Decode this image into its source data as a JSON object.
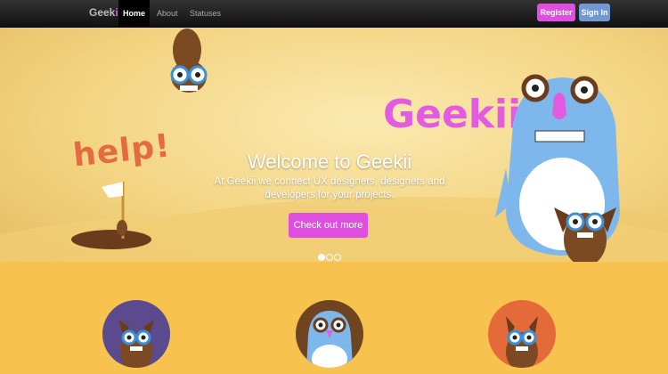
{
  "navbar": {
    "brand_prefix": "Geek",
    "brand_suffix": "ii",
    "items": [
      {
        "label": "Home",
        "active": true
      },
      {
        "label": "About",
        "active": false
      },
      {
        "label": "Statuses",
        "active": false
      }
    ],
    "register_label": "Register",
    "signin_label": "Sign In"
  },
  "hero": {
    "help_text": "help!",
    "logo_text": "Geekii",
    "title": "Welcome to Geekii",
    "subtitle": "At Geekii we connect UX designers, designers and developers for your projects.",
    "cta_label": "Check out more",
    "carousel": {
      "count": 3,
      "active_index": 0
    }
  },
  "features": {
    "circle_colors": [
      "#5b4a8d",
      "#6e4520",
      "#e56a3a"
    ]
  },
  "colors": {
    "accent_pink": "#e04ee0",
    "accent_blue": "#7397d3",
    "band_yellow": "#f7c24e",
    "monster_blue": "#7db7ec",
    "owl_brown": "#7b4a22"
  }
}
